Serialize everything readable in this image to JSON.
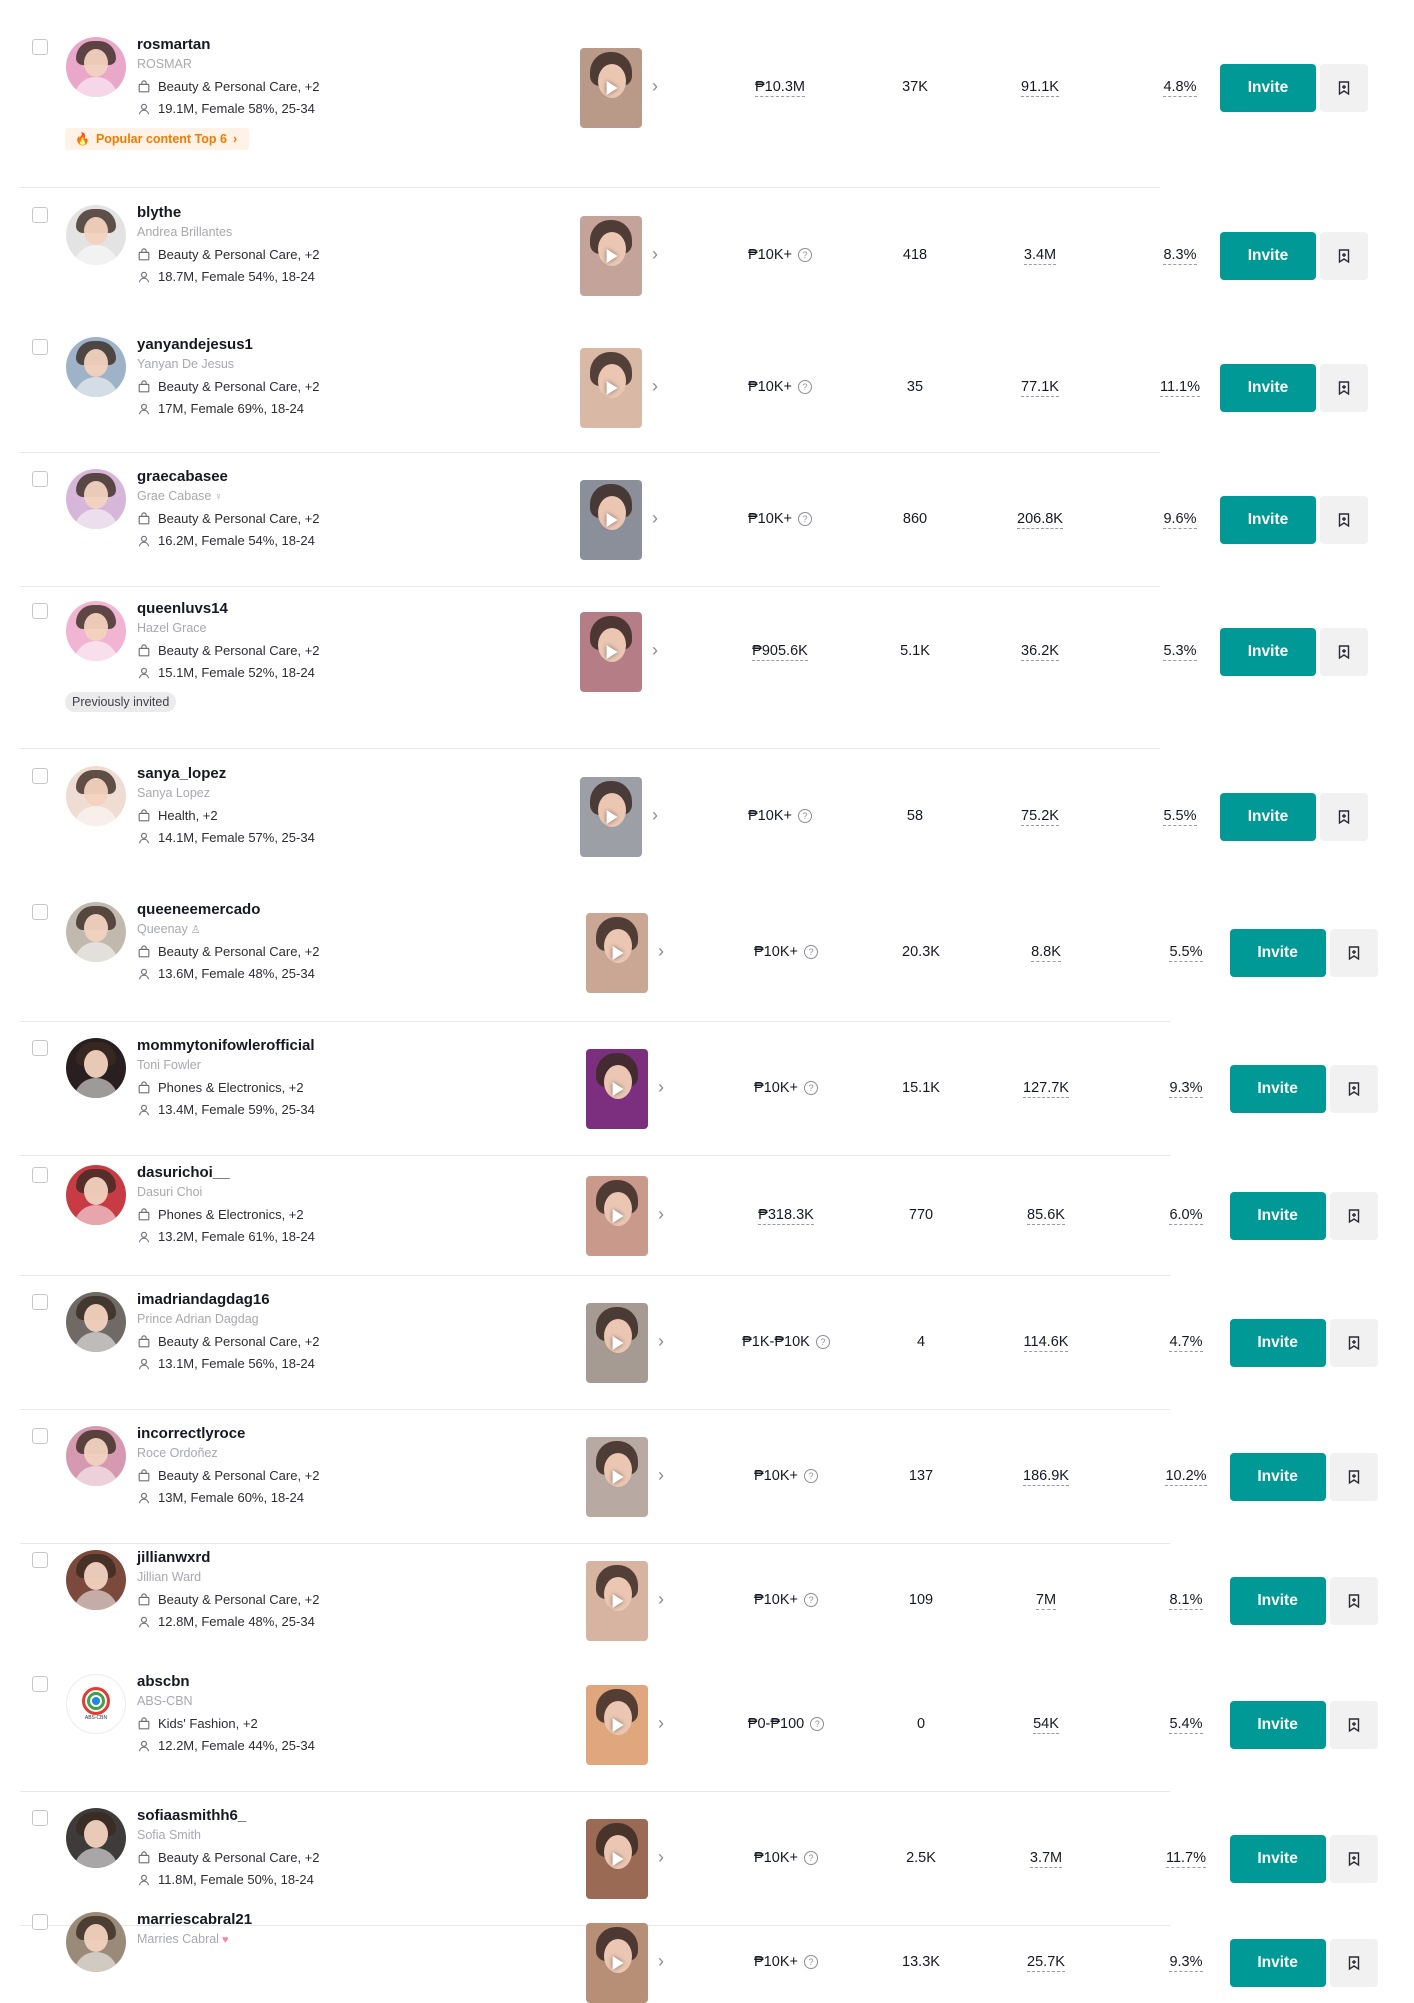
{
  "invite_label": "Invite",
  "rows": [
    {
      "username": "rosmartan",
      "display": "ROSMAR",
      "display_extra": "",
      "category": "Beauty & Personal Care, +2",
      "demo": "19.1M, Female 58%, 25-34",
      "gmv": "₱10.3M",
      "gmv_tip": false,
      "col2": "37K",
      "col3": "91.1K",
      "col4": "4.8%",
      "badge": "Popular content Top 6",
      "badge_type": "popular",
      "avatar_color": "#e9a7c9",
      "thumb_color": "#b99a88"
    },
    {
      "username": "blythe",
      "display": "Andrea Brillantes",
      "display_extra": "",
      "category": "Beauty & Personal Care, +2",
      "demo": "18.7M, Female 54%, 18-24",
      "gmv": "₱10K+",
      "gmv_tip": true,
      "col2": "418",
      "col3": "3.4M",
      "col4": "8.3%",
      "badge": "",
      "badge_type": "",
      "avatar_color": "#e3e3e3",
      "thumb_color": "#c3a39a"
    },
    {
      "username": "yanyandejesus1",
      "display": "Yanyan De Jesus",
      "display_extra": "",
      "category": "Beauty & Personal Care, +2",
      "demo": "17M, Female 69%, 18-24",
      "gmv": "₱10K+",
      "gmv_tip": true,
      "col2": "35",
      "col3": "77.1K",
      "col4": "11.1%",
      "badge": "",
      "badge_type": "",
      "avatar_color": "#9fb3c8",
      "thumb_color": "#d9b8a5"
    },
    {
      "username": "graecabasee",
      "display": "Grae Cabase",
      "display_extra": "♀",
      "category": "Beauty & Personal Care, +2",
      "demo": "16.2M, Female 54%, 18-24",
      "gmv": "₱10K+",
      "gmv_tip": true,
      "col2": "860",
      "col3": "206.8K",
      "col4": "9.6%",
      "badge": "",
      "badge_type": "",
      "avatar_color": "#d7b7d9",
      "thumb_color": "#8a8f9a"
    },
    {
      "username": "queenluvs14",
      "display": "Hazel Grace",
      "display_extra": "",
      "category": "Beauty & Personal Care, +2",
      "demo": "15.1M, Female 52%, 18-24",
      "gmv": "₱905.6K",
      "gmv_tip": false,
      "col2": "5.1K",
      "col3": "36.2K",
      "col4": "5.3%",
      "badge": "Previously invited",
      "badge_type": "prev",
      "avatar_color": "#f1b5d3",
      "thumb_color": "#b57e86"
    },
    {
      "username": "sanya_lopez",
      "display": "Sanya Lopez",
      "display_extra": "",
      "category": "Health, +2",
      "demo": "14.1M, Female 57%, 25-34",
      "gmv": "₱10K+",
      "gmv_tip": true,
      "col2": "58",
      "col3": "75.2K",
      "col4": "5.5%",
      "badge": "",
      "badge_type": "",
      "avatar_color": "#efdcd2",
      "thumb_color": "#9c9fa5"
    },
    {
      "username": "queeneemercado",
      "display": "Queenay",
      "display_extra": "♙",
      "category": "Beauty & Personal Care, +2",
      "demo": "13.6M, Female 48%, 25-34",
      "gmv": "₱10K+",
      "gmv_tip": true,
      "col2": "20.3K",
      "col3": "8.8K",
      "col4": "5.5%",
      "badge": "",
      "badge_type": "",
      "avatar_color": "#c2b9ae",
      "thumb_color": "#c9a794"
    },
    {
      "username": "mommytonifowlerofficial",
      "display": "Toni Fowler",
      "display_extra": "",
      "category": "Phones & Electronics, +2",
      "demo": "13.4M, Female 59%, 25-34",
      "gmv": "₱10K+",
      "gmv_tip": true,
      "col2": "15.1K",
      "col3": "127.7K",
      "col4": "9.3%",
      "badge": "",
      "badge_type": "",
      "avatar_color": "#2a1f20",
      "thumb_color": "#7b2f7e"
    },
    {
      "username": "dasurichoi__",
      "display": "Dasuri Choi",
      "display_extra": "",
      "category": "Phones & Electronics, +2",
      "demo": "13.2M, Female 61%, 18-24",
      "gmv": "₱318.3K",
      "gmv_tip": false,
      "col2": "770",
      "col3": "85.6K",
      "col4": "6.0%",
      "badge": "",
      "badge_type": "",
      "avatar_color": "#c73b45",
      "thumb_color": "#c99a8c"
    },
    {
      "username": "imadriandagdag16",
      "display": "Prince Adrian Dagdag",
      "display_extra": "",
      "category": "Beauty & Personal Care, +2",
      "demo": "13.1M, Female 56%, 18-24",
      "gmv": "₱1K-₱10K",
      "gmv_tip": true,
      "col2": "4",
      "col3": "114.6K",
      "col4": "4.7%",
      "badge": "",
      "badge_type": "",
      "avatar_color": "#6f6a66",
      "thumb_color": "#a59b93"
    },
    {
      "username": "incorrectlyroce",
      "display": "Roce Ordoñez",
      "display_extra": "",
      "category": "Beauty & Personal Care, +2",
      "demo": "13M, Female 60%, 18-24",
      "gmv": "₱10K+",
      "gmv_tip": true,
      "col2": "137",
      "col3": "186.9K",
      "col4": "10.2%",
      "badge": "",
      "badge_type": "",
      "avatar_color": "#d59ab0",
      "thumb_color": "#b8aaa3"
    },
    {
      "username": "jillianwxrd",
      "display": "Jillian Ward",
      "display_extra": "",
      "category": "Beauty & Personal Care, +2",
      "demo": "12.8M, Female 48%, 25-34",
      "gmv": "₱10K+",
      "gmv_tip": true,
      "col2": "109",
      "col3": "7M",
      "col4": "8.1%",
      "badge": "",
      "badge_type": "",
      "avatar_color": "#7c4a3c",
      "thumb_color": "#d7b3a2"
    },
    {
      "username": "abscbn",
      "display": "ABS-CBN",
      "display_extra": "",
      "category": "Kids' Fashion, +2",
      "demo": "12.2M, Female 44%, 25-34",
      "gmv": "₱0-₱100",
      "gmv_tip": true,
      "col2": "0",
      "col3": "54K",
      "col4": "5.4%",
      "badge": "",
      "badge_type": "",
      "avatar_color": "#ffffff",
      "thumb_color": "#e0a77e",
      "logo": true
    },
    {
      "username": "sofiaasmithh6_",
      "display": "Sofia Smith",
      "display_extra": "",
      "category": "Beauty & Personal Care, +2",
      "demo": "11.8M, Female 50%, 18-24",
      "gmv": "₱10K+",
      "gmv_tip": true,
      "col2": "2.5K",
      "col3": "3.7M",
      "col4": "11.7%",
      "badge": "",
      "badge_type": "",
      "avatar_color": "#3f3b3b",
      "thumb_color": "#9b6a55"
    },
    {
      "username": "marriescabral21",
      "display": "Marries Cabral",
      "display_extra": "♥",
      "category": "",
      "demo": "",
      "gmv": "₱10K+",
      "gmv_tip": true,
      "col2": "13.3K",
      "col3": "25.7K",
      "col4": "9.3%",
      "badge": "",
      "badge_type": "",
      "avatar_color": "#9a8b78",
      "thumb_color": "#b78f77"
    }
  ]
}
